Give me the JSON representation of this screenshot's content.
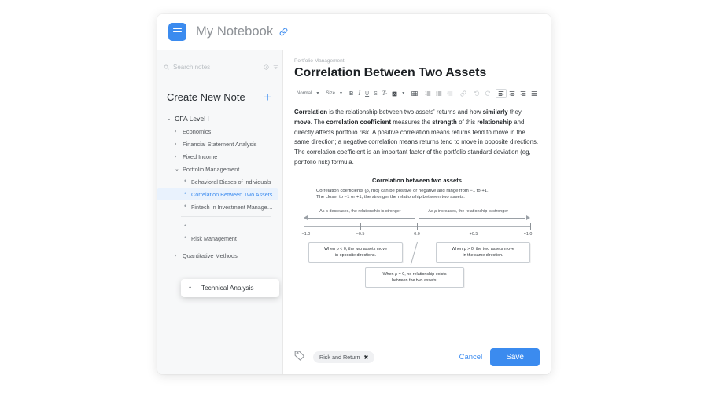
{
  "header": {
    "title": "My Notebook",
    "logo_icon": "hamburger-icon",
    "link_icon": "link-icon",
    "accent": "#3b8bef"
  },
  "sidebar": {
    "search": {
      "placeholder": "Search notes",
      "search_icon": "search-icon",
      "info_icon": "info-icon",
      "filter_icon": "filter-icon"
    },
    "create": {
      "label": "Create New Note",
      "plus": "+"
    },
    "tree": [
      {
        "level": 1,
        "label": "CFA Level I",
        "marker": "caret-down",
        "selected": false
      },
      {
        "level": 2,
        "label": "Economics",
        "marker": "caret-right",
        "selected": false
      },
      {
        "level": 2,
        "label": "Financial Statement Analysis",
        "marker": "caret-right",
        "selected": false
      },
      {
        "level": 2,
        "label": "Fixed Income",
        "marker": "caret-right",
        "selected": false
      },
      {
        "level": 2,
        "label": "Portfolio Management",
        "marker": "caret-down",
        "selected": false
      },
      {
        "level": 3,
        "label": "Behavioral Biases of Individuals",
        "marker": "bullet",
        "selected": false
      },
      {
        "level": 3,
        "label": "Correlation Between Two Assets",
        "marker": "bullet",
        "selected": true
      },
      {
        "level": 3,
        "label": "Fintech In Investment Manage…",
        "marker": "bullet",
        "selected": false
      },
      {
        "level": 3,
        "label": "",
        "marker": "bullet",
        "selected": false
      },
      {
        "level": 3,
        "label": "Risk Management",
        "marker": "bullet",
        "selected": false
      },
      {
        "level": 2,
        "label": "Quantitative Methods",
        "marker": "caret-right",
        "selected": false
      }
    ],
    "drag_item": {
      "label": "Technical Analysis",
      "marker": "bullet"
    }
  },
  "main": {
    "breadcrumb": "Portfolio Management",
    "title": "Correlation Between Two Assets",
    "toolbar": {
      "style_select": "Normal",
      "size_select": "Size",
      "items": [
        "bold",
        "italic",
        "underline",
        "strikethrough",
        "clear-format",
        "text-color",
        "table",
        "ordered-list",
        "bullet-list",
        "indent",
        "link",
        "undo",
        "redo",
        "align-left",
        "align-center",
        "align-right",
        "align-justify"
      ]
    },
    "paragraph": {
      "segments": [
        {
          "t": "Correlation",
          "b": true
        },
        {
          "t": " is the relationship between two assets' returns and how ",
          "b": false
        },
        {
          "t": "similarly",
          "b": true
        },
        {
          "t": " they ",
          "b": false
        },
        {
          "t": "move",
          "b": true
        },
        {
          "t": ".  The ",
          "b": false
        },
        {
          "t": "correlation coefficient",
          "b": true
        },
        {
          "t": " measures the ",
          "b": false
        },
        {
          "t": "strength",
          "b": true
        },
        {
          "t": " of this ",
          "b": false
        },
        {
          "t": "relationship",
          "b": true
        },
        {
          "t": " and directly affects portfolio risk.  A positive correlation means returns tend to move in the same direction; a negative correlation means returns tend to move in opposite directions.  The correlation coefficient is an important factor of the portfolio standard deviation (eg, portfolio risk) formula.",
          "b": false
        }
      ]
    }
  },
  "chart_data": {
    "type": "line",
    "title": "Correlation between two assets",
    "subtitle_line1": "Correlation coefficients (ρ, rho) can be positive or negative and range from −1 to +1.",
    "subtitle_line2": "The closer to −1 or +1, the stronger the relationship between two assets.",
    "xlabel": "",
    "ylabel": "",
    "xlim": [
      -1.0,
      1.0
    ],
    "grid": false,
    "tick_labels": [
      "−1.0",
      "−0.5",
      "0.0",
      "+0.5",
      "+1.0"
    ],
    "tick_values": [
      -1.0,
      -0.5,
      0.0,
      0.5,
      1.0
    ],
    "annotations": [
      {
        "text": "As ρ decreases, the relationship is stronger",
        "direction": "left",
        "range": [
          -1.0,
          0.0
        ]
      },
      {
        "text": "As ρ increases, the relationship is stronger",
        "direction": "right",
        "range": [
          0.0,
          1.0
        ]
      }
    ],
    "callouts": [
      {
        "text_line1": "When ρ < 0, the two assets move",
        "text_line2": "in opposite directions.",
        "at": -0.5
      },
      {
        "text_line1": "When ρ > 0, the two assets move",
        "text_line2": "in the same direction.",
        "at": 0.5
      },
      {
        "text_line1": "When ρ = 0, no relationship exists",
        "text_line2": "between the two assets.",
        "at": 0.0
      }
    ]
  },
  "footer": {
    "tag_icon": "tag-icon",
    "tag_label": "Risk and Return",
    "tag_remove": "✖",
    "cancel_label": "Cancel",
    "save_label": "Save",
    "save_color": "#3b8bef"
  }
}
